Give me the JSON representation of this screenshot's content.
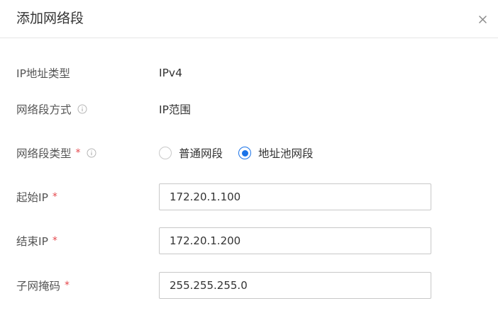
{
  "dialog": {
    "title": "添加网络段",
    "close_icon": "close-icon"
  },
  "form": {
    "ip_type": {
      "label": "IP地址类型",
      "value": "IPv4"
    },
    "segment_mode": {
      "label": "网络段方式",
      "value": "IP范围",
      "icon": "info-icon"
    },
    "segment_type": {
      "label": "网络段类型",
      "required_mark": "*",
      "icon": "info-icon",
      "options": [
        {
          "label": "普通网段",
          "checked": false
        },
        {
          "label": "地址池网段",
          "checked": true
        }
      ]
    },
    "start_ip": {
      "label": "起始IP",
      "required_mark": "*",
      "value": "172.20.1.100"
    },
    "end_ip": {
      "label": "结束IP",
      "required_mark": "*",
      "value": "172.20.1.200"
    },
    "subnet_mask": {
      "label": "子网掩码",
      "required_mark": "*",
      "value": "255.255.255.0"
    }
  },
  "colors": {
    "accent": "#1a73e8",
    "required": "#e5484d",
    "border": "#c8c8c8",
    "divider": "#e6e6e6"
  }
}
